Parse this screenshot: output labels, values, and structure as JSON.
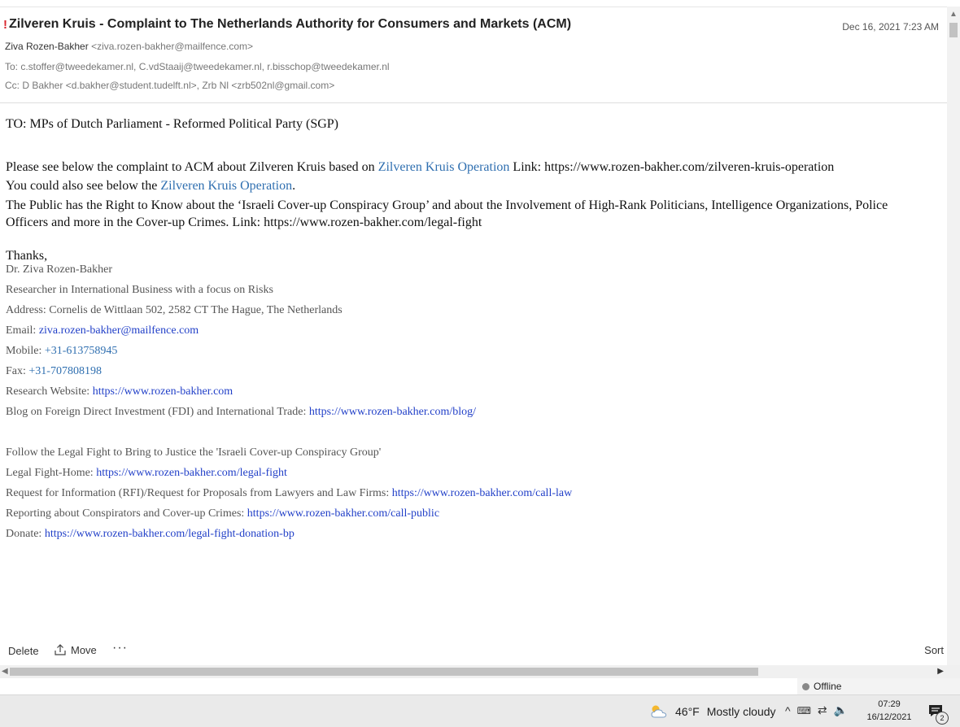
{
  "email": {
    "flag": "!",
    "subject": "Zilveren Kruis - Complaint to The Netherlands Authority for Consumers and Markets (ACM)",
    "date": "Dec 16, 2021 7:23 AM",
    "from_name": "Ziva Rozen-Bakher",
    "from_addr": "<ziva.rozen-bakher@mailfence.com>",
    "to": "To: c.stoffer@tweedekamer.nl, C.vdStaaij@tweedekamer.nl, r.bisschop@tweedekamer.nl",
    "cc": "Cc: D Bakher <d.bakher@student.tudelft.nl>, Zrb Nl <zrb502nl@gmail.com>"
  },
  "body": {
    "greeting": "TO: MPs of Dutch Parliament - Reformed Political Party (SGP)",
    "para1_a": "Please see below the complaint to ACM about Zilveren Kruis based on ",
    "para1_link": "Zilveren Kruis Operation",
    "para1_b": " Link: https://www.rozen-bakher.com/zilveren-kruis-operation",
    "para2_a": "You could also see below the ",
    "para2_link": "Zilveren Kruis Operation",
    "para2_b": ".",
    "para3": "The Public has the Right to Know about the ‘Israeli Cover-up Conspiracy Group’ and about the Involvement of High-Rank Politicians, Intelligence Organizations, Police Officers and more in the Cover-up Crimes. Link: https://www.rozen-bakher.com/legal-fight",
    "thanks": "Thanks,"
  },
  "signature": {
    "name": "Dr. Ziva Rozen-Bakher",
    "title": "Researcher in International Business with a focus on Risks",
    "address": "Address: Cornelis de Wittlaan 502, 2582 CT The Hague, The Netherlands",
    "email_label": "Email: ",
    "email": "ziva.rozen-bakher@mailfence.com",
    "mobile_label": "Mobile: ",
    "mobile": "+31-613758945",
    "fax_label": "Fax: ",
    "fax": "+31-707808198",
    "website_label": "Research Website: ",
    "website": "https://www.rozen-bakher.com",
    "blog_label": "Blog on Foreign Direct Investment (FDI) and International Trade: ",
    "blog": "https://www.rozen-bakher.com/blog/",
    "follow": "Follow the Legal Fight to Bring to Justice the 'Israeli Cover-up Conspiracy Group'",
    "legal_label": "Legal Fight-Home: ",
    "legal": "https://www.rozen-bakher.com/legal-fight",
    "rfi_label": "Request for Information (RFI)/Request for Proposals from Lawyers and Law Firms: ",
    "rfi": "https://www.rozen-bakher.com/call-law",
    "report_label": "Reporting about Conspirators and Cover-up Crimes: ",
    "report": "https://www.rozen-bakher.com/call-public",
    "donate_label": "Donate: ",
    "donate": "https://www.rozen-bakher.com/legal-fight-donation-bp"
  },
  "toolbar": {
    "delete": "Delete",
    "move": "Move",
    "more": "···",
    "sort": "Sort"
  },
  "status": {
    "offline": "Offline"
  },
  "taskbar": {
    "temp": "46°F",
    "weather": "Mostly cloudy",
    "time": "07:29",
    "date": "16/12/2021",
    "notifications": "2"
  },
  "icons": {
    "weather": "partly-cloudy-icon",
    "chevron_up": "chevron-up-icon",
    "keyboard": "keyboard-icon",
    "network": "network-icon",
    "volume": "volume-icon",
    "notification": "notification-icon"
  }
}
